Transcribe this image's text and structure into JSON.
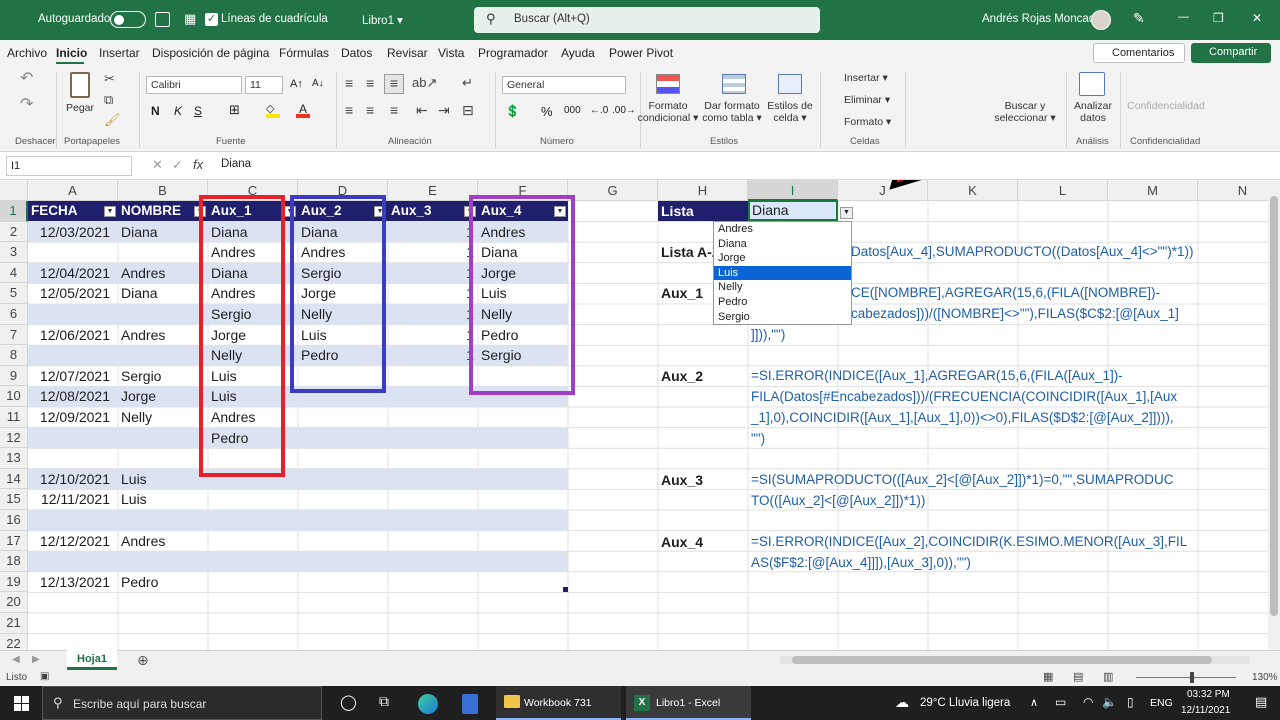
{
  "titlebar": {
    "autosave": "Autoguardado",
    "gridlines": "Líneas de cuadrícula",
    "book": "Libro1 ▾",
    "search": "Buscar (Alt+Q)",
    "user": "Andrés Rojas Moncada",
    "minimize": "—",
    "restore": "❐",
    "close": "✕"
  },
  "menu": [
    "Archivo",
    "Inicio",
    "Insertar",
    "Disposición de página",
    "Fórmulas",
    "Datos",
    "Revisar",
    "Vista",
    "Programador",
    "Ayuda",
    "Power Pivot"
  ],
  "menu_right": {
    "comments": "Comentarios",
    "share": "Compartir"
  },
  "ribbon": {
    "groups": {
      "undo": "Deshacer",
      "clipboard": "Portapapeles",
      "font": "Fuente",
      "alignment": "Alineación",
      "number": "Número",
      "styles": "Estilos",
      "cells": "Celdas",
      "analysis": "Análisis",
      "confidentiality": "Confidencialidad"
    },
    "paste": "Pegar",
    "font_name": "Calibri",
    "font_size": "11",
    "number_format": "General",
    "format_conditional": "Formato condicional ▾",
    "format_table": "Dar formato como tabla ▾",
    "cell_styles": "Estilos de celda ▾",
    "insert": "Insertar ▾",
    "delete": "Eliminar ▾",
    "format": "Formato ▾",
    "find_select": "Buscar y seleccionar ▾",
    "analyze": "Analizar datos",
    "confidentiality_btn": "Confidencialidad",
    "bold": "N",
    "italic": "K",
    "underline": "S",
    "percent": "%",
    "thousands": "000"
  },
  "formula_bar": {
    "namebox": "I1",
    "fx": "fx",
    "content": "Diana"
  },
  "columns": [
    "A",
    "B",
    "C",
    "D",
    "E",
    "F",
    "G",
    "H",
    "I",
    "J",
    "K",
    "L",
    "M",
    "N"
  ],
  "rows": [
    "1",
    "2",
    "3",
    "4",
    "5",
    "6",
    "7",
    "8",
    "9",
    "10",
    "11",
    "12",
    "13",
    "14",
    "15",
    "16",
    "17",
    "18",
    "19",
    "20",
    "21",
    "22"
  ],
  "table_headers": {
    "fecha": "FECHA",
    "nombre": "NOMBRE",
    "aux1": "Aux_1",
    "aux2": "Aux_2",
    "aux3": "Aux_3",
    "aux4": "Aux_4"
  },
  "data_rows": [
    {
      "fecha": "12/03/2021",
      "nombre": "Diana",
      "aux1": "Diana",
      "aux2": "Diana",
      "aux3": "1",
      "aux4": "Andres"
    },
    {
      "fecha": "",
      "nombre": "",
      "aux1": "Andres",
      "aux2": "Andres",
      "aux3": "1",
      "aux4": "Diana"
    },
    {
      "fecha": "12/04/2021",
      "nombre": "Andres",
      "aux1": "Diana",
      "aux2": "Sergio",
      "aux3": "1",
      "aux4": "Jorge"
    },
    {
      "fecha": "12/05/2021",
      "nombre": "Diana",
      "aux1": "Andres",
      "aux2": "Jorge",
      "aux3": "1",
      "aux4": "Luis"
    },
    {
      "fecha": "",
      "nombre": "",
      "aux1": "Sergio",
      "aux2": "Nelly",
      "aux3": "1",
      "aux4": "Nelly"
    },
    {
      "fecha": "12/06/2021",
      "nombre": "Andres",
      "aux1": "Jorge",
      "aux2": "Luis",
      "aux3": "1",
      "aux4": "Pedro"
    },
    {
      "fecha": "",
      "nombre": "",
      "aux1": "Nelly",
      "aux2": "Pedro",
      "aux3": "1",
      "aux4": "Sergio"
    },
    {
      "fecha": "12/07/2021",
      "nombre": "Sergio",
      "aux1": "Luis",
      "aux2": "",
      "aux3": "",
      "aux4": ""
    },
    {
      "fecha": "12/08/2021",
      "nombre": "Jorge",
      "aux1": "Luis",
      "aux2": "",
      "aux3": "",
      "aux4": ""
    },
    {
      "fecha": "12/09/2021",
      "nombre": "Nelly",
      "aux1": "Andres",
      "aux2": "",
      "aux3": "",
      "aux4": ""
    },
    {
      "fecha": "",
      "nombre": "",
      "aux1": "Pedro",
      "aux2": "",
      "aux3": "",
      "aux4": ""
    },
    {
      "fecha": "",
      "nombre": "",
      "aux1": "",
      "aux2": "",
      "aux3": "",
      "aux4": ""
    },
    {
      "fecha": "12/10/2021",
      "nombre": "Luis",
      "aux1": "",
      "aux2": "",
      "aux3": "",
      "aux4": ""
    },
    {
      "fecha": "12/11/2021",
      "nombre": "Luis",
      "aux1": "",
      "aux2": "",
      "aux3": "",
      "aux4": ""
    },
    {
      "fecha": "",
      "nombre": "",
      "aux1": "",
      "aux2": "",
      "aux3": "",
      "aux4": ""
    },
    {
      "fecha": "12/12/2021",
      "nombre": "Andres",
      "aux1": "",
      "aux2": "",
      "aux3": "",
      "aux4": ""
    },
    {
      "fecha": "",
      "nombre": "",
      "aux1": "",
      "aux2": "",
      "aux3": "",
      "aux4": ""
    },
    {
      "fecha": "12/13/2021",
      "nombre": "Pedro",
      "aux1": "",
      "aux2": "",
      "aux3": "",
      "aux4": ""
    }
  ],
  "side": {
    "lista": "Lista",
    "lista_value": "Diana",
    "lista_az": "Lista A-Z",
    "aux1": "Aux_1",
    "aux2": "Aux_2",
    "aux3": "Aux_3",
    "aux4": "Aux_4"
  },
  "formulas": {
    "lista_az": "Datos[Aux_4],SUMAPRODUCTO((Datos[Aux_4]<>\"\")*1))",
    "aux1": [
      "CE([NOMBRE],AGREGAR(15,6,(FILA([NOMBRE])-",
      "cabezados]))/([NOMBRE]<>\"\"),FILAS($C$2:[@[Aux_1]",
      "]])),\"\")"
    ],
    "aux2": [
      "=SI.ERROR(INDICE([Aux_1],AGREGAR(15,6,(FILA([Aux_1])-",
      "FILA(Datos[#Encabezados]))/(FRECUENCIA(COINCIDIR([Aux_1],[Aux",
      "_1],0),COINCIDIR([Aux_1],[Aux_1],0))<>0),FILAS($D$2:[@[Aux_2]]))),",
      "\"\")"
    ],
    "aux3": [
      "=SI(SUMAPRODUCTO(([Aux_2]<[@[Aux_2]])*1)=0,\"\",SUMAPRODUC",
      "TO(([Aux_2]<[@[Aux_2]])*1))"
    ],
    "aux4": [
      "=SI.ERROR(INDICE([Aux_2],COINCIDIR(K.ESIMO.MENOR([Aux_3],FIL",
      "AS($F$2:[@[Aux_4]]]),[Aux_3],0)),\"\")"
    ]
  },
  "dropdown": {
    "items": [
      "Andres",
      "Diana",
      "Jorge",
      "Luis",
      "Nelly",
      "Pedro",
      "Sergio"
    ],
    "selected_index": 3
  },
  "sheet_tab": "Hoja1",
  "status": {
    "ready": "Listo",
    "zoom": "130%"
  },
  "taskbar": {
    "search": "Escribe aquí para buscar",
    "explorer": "Workbook 731",
    "excel": "Libro1 - Excel",
    "weather": "29°C  Lluvia ligera",
    "lang": "ENG",
    "time": "03:32 PM",
    "date": "12/11/2021"
  },
  "colors": {
    "excel_green": "#217346",
    "table_header": "#1f1f6e",
    "band": "#dbe3f3",
    "formula_text": "#1f5fa8",
    "red": "#e8202a",
    "blue": "#3b3bc4",
    "purple": "#a23ec4",
    "selected": "#0a64d6"
  },
  "icons": {
    "save": "save-icon",
    "undo": "undo-icon",
    "redo": "redo-icon",
    "cut": "scissors-icon",
    "copy": "copy-icon",
    "paint": "format-painter-icon",
    "search": "search-icon",
    "pen": "pen-icon",
    "fx": "function-icon",
    "arrow": "red-arrow-annotation"
  }
}
